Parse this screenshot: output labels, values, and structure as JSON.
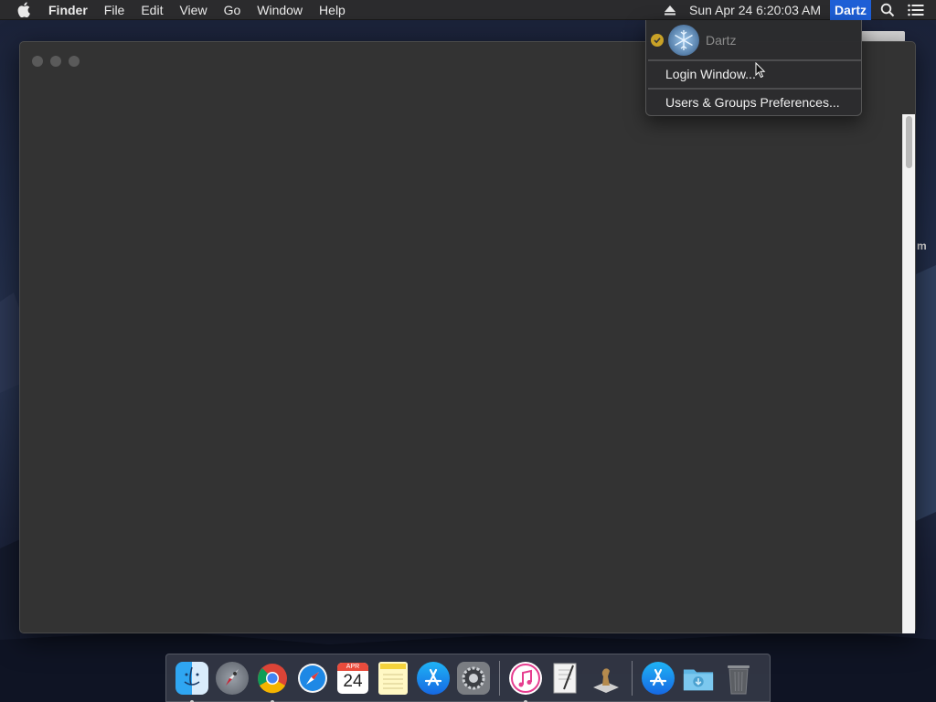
{
  "menubar": {
    "app_name": "Finder",
    "menus": [
      "File",
      "Edit",
      "View",
      "Go",
      "Window",
      "Help"
    ],
    "clock": "Sun Apr 24  6:20:03 AM",
    "user": "Dartz"
  },
  "user_menu": {
    "current_user": "Dartz",
    "items": [
      "Login Window...",
      "Users & Groups Preferences..."
    ]
  },
  "background_text": "m",
  "dock": {
    "calendar_month": "APR",
    "calendar_day": "24",
    "apps": [
      "finder-icon",
      "launchpad-icon",
      "chrome-icon",
      "safari-icon",
      "calendar-icon",
      "notes-icon",
      "app-store-icon",
      "system-preferences-icon",
      "itunes-icon",
      "preview-icon",
      "chess-icon",
      "app-store-download-icon",
      "downloads-folder-icon",
      "trash-icon"
    ]
  }
}
